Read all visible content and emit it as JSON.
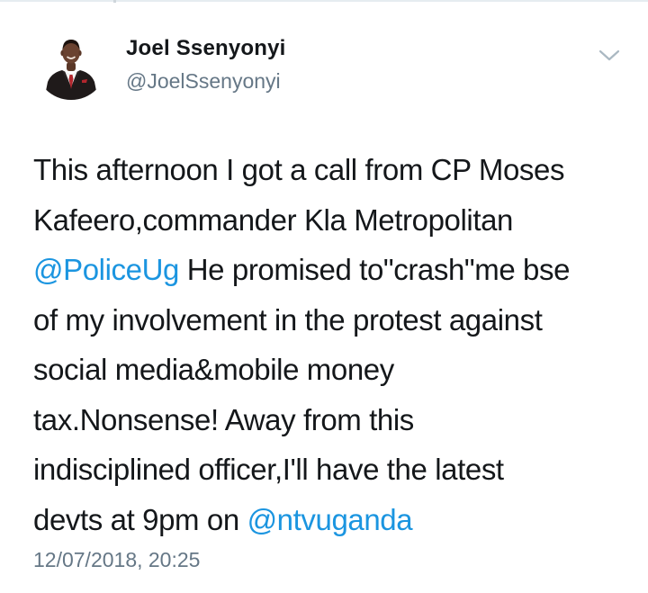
{
  "tweet": {
    "author": {
      "display_name": "Joel Ssenyonyi",
      "handle": "@JoelSsenyonyi"
    },
    "lines": [
      [
        {
          "text": "This afternoon I got a call from CP Moses"
        }
      ],
      [
        {
          "text": "Kafeero,commander Kla Metropolitan"
        }
      ],
      [
        {
          "text": "@PoliceUg",
          "mention": true
        },
        {
          "text": " He promised to\"crash\"me bse"
        }
      ],
      [
        {
          "text": "of my involvement in the protest against"
        }
      ],
      [
        {
          "text": "social media&mobile money"
        }
      ],
      [
        {
          "text": "tax.Nonsense! Away from this"
        }
      ],
      [
        {
          "text": "indisciplined officer,I'll have the latest"
        }
      ],
      [
        {
          "text": "devts at 9pm on "
        },
        {
          "text": "@ntvuganda",
          "mention": true
        }
      ]
    ],
    "timestamp": "12/07/2018, 20:25"
  },
  "icons": {
    "avatar": "profile-photo",
    "menu": "chevron-down-icon"
  },
  "colors": {
    "text": "#14171a",
    "secondary": "#657786",
    "link": "#1b95e0",
    "background": "#ffffff"
  }
}
